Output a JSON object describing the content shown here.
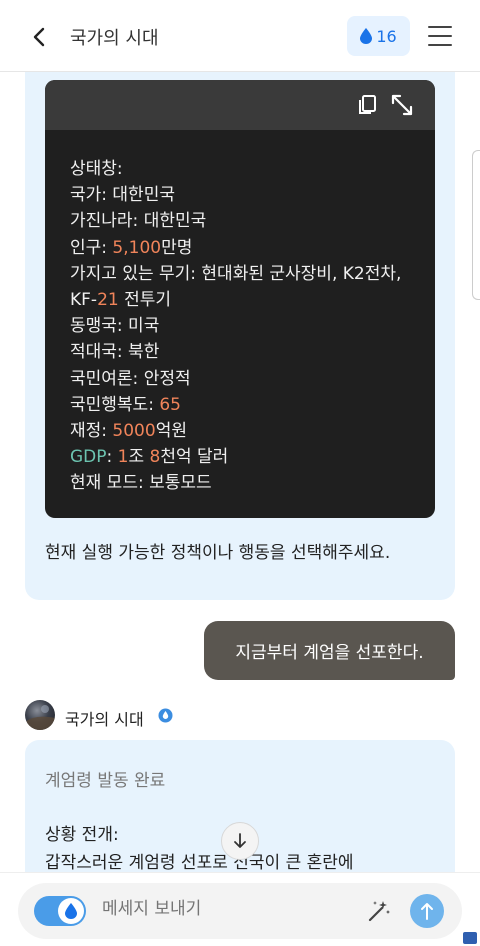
{
  "header": {
    "title": "국가의 시대",
    "drops_count": "16"
  },
  "code_block": {
    "lines": [
      [
        {
          "t": "상태창:"
        }
      ],
      [
        {
          "t": "국가: 대한민국"
        }
      ],
      [
        {
          "t": "가진나라: 대한민국"
        }
      ],
      [
        {
          "t": "인구: "
        },
        {
          "t": "5,100",
          "c": "num"
        },
        {
          "t": "만명"
        }
      ],
      [
        {
          "t": "가지고 있는 무기: 현대화된 군사장비, K2전차,"
        }
      ],
      [
        {
          "t": "KF-"
        },
        {
          "t": "21",
          "c": "num"
        },
        {
          "t": " 전투기"
        }
      ],
      [
        {
          "t": "동맹국: 미국"
        }
      ],
      [
        {
          "t": "적대국: 북한"
        }
      ],
      [
        {
          "t": "국민여론: 안정적"
        }
      ],
      [
        {
          "t": "국민행복도: "
        },
        {
          "t": "65",
          "c": "num"
        }
      ],
      [
        {
          "t": "재정: "
        },
        {
          "t": "5000",
          "c": "num"
        },
        {
          "t": "억원"
        }
      ],
      [
        {
          "t": "GDP",
          "c": "key-green"
        },
        {
          "t": ": "
        },
        {
          "t": "1",
          "c": "num"
        },
        {
          "t": "조 "
        },
        {
          "t": "8",
          "c": "num"
        },
        {
          "t": "천억 달러"
        }
      ],
      [
        {
          "t": "현재 모드: 보통모드"
        }
      ]
    ]
  },
  "messages": {
    "bot_prompt": "현재 실행 가능한 정책이나 행동을 선택해주세요.",
    "user_message": "지금부터 계엄을 선포한다.",
    "bot_name": "국가의 시대",
    "bot_reply_title": "계엄령 발동 완료",
    "bot_reply_heading": "상황 전개:",
    "bot_reply_body": "갑작스러운 계엄령 선포로 전국이 큰 혼란에"
  },
  "input": {
    "placeholder": "메세지 보내기"
  },
  "colors": {
    "accent": "#4a9ce8",
    "bubble_bg": "#e7f3fd",
    "user_bubble": "#5a5650",
    "code_bg": "#1f1f1f",
    "number": "#f0845a",
    "key_green": "#6cc4b0"
  }
}
